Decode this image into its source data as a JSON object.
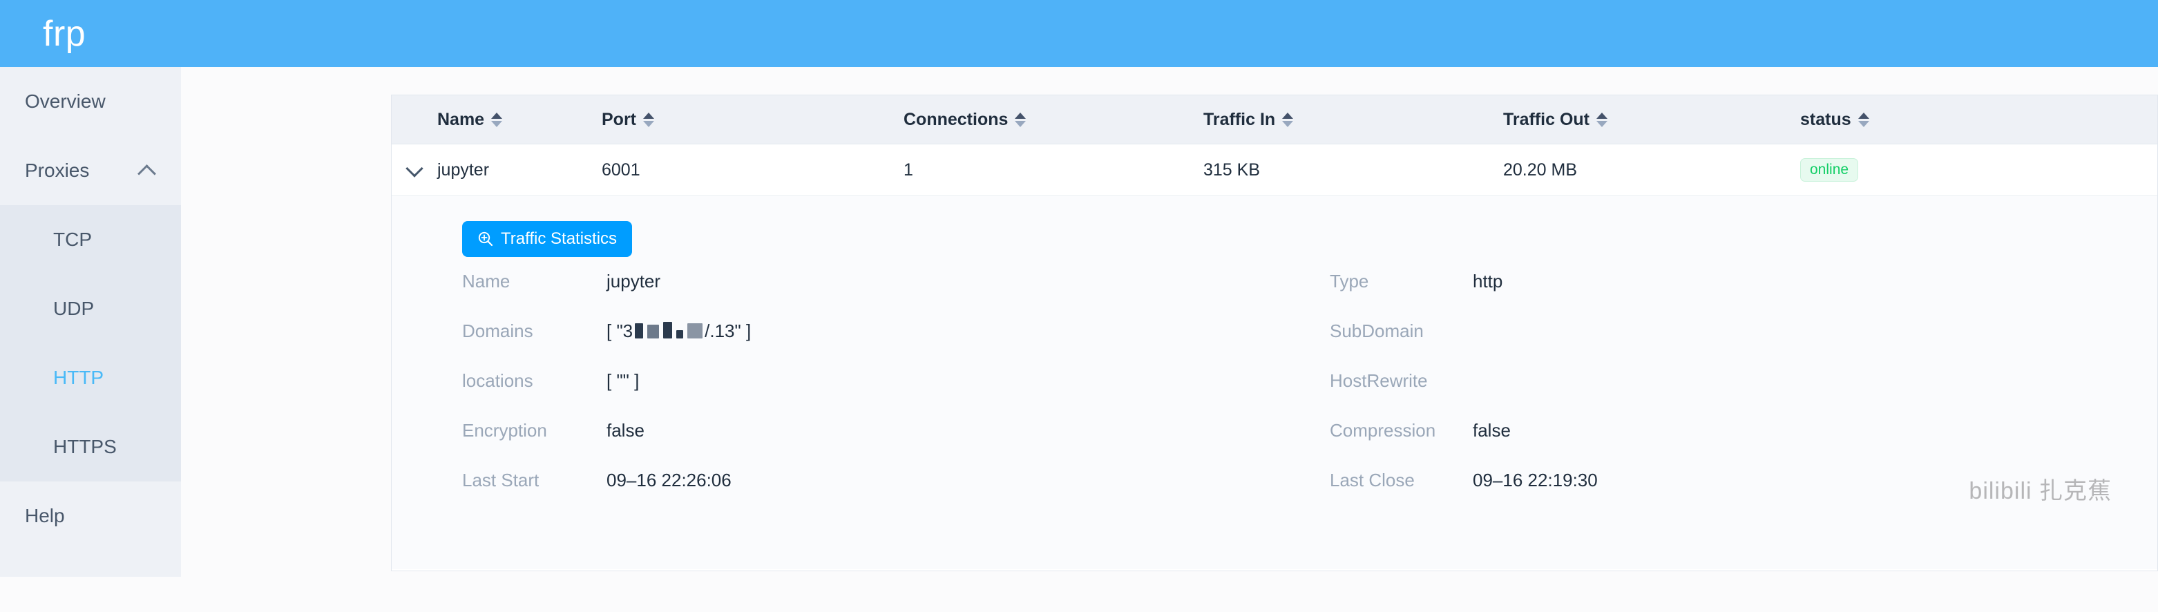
{
  "header": {
    "logo": "frp",
    "brand_color": "#4fb2f8"
  },
  "sidebar": {
    "overview_label": "Overview",
    "proxies_label": "Proxies",
    "proxies_collapse_icon": "chevron-up-icon",
    "submenu": [
      {
        "label": "TCP",
        "active": false
      },
      {
        "label": "UDP",
        "active": false
      },
      {
        "label": "HTTP",
        "active": true
      },
      {
        "label": "HTTPS",
        "active": false
      }
    ],
    "help_label": "Help",
    "active_color": "#49b9f7"
  },
  "table": {
    "columns": [
      {
        "label": "Name",
        "sort_icon": "sort-icon"
      },
      {
        "label": "Port",
        "sort_icon": "sort-icon"
      },
      {
        "label": "Connections",
        "sort_icon": "sort-icon"
      },
      {
        "label": "Traffic In",
        "sort_icon": "sort-icon"
      },
      {
        "label": "Traffic Out",
        "sort_icon": "sort-icon"
      },
      {
        "label": "status",
        "sort_icon": "sort-icon"
      }
    ],
    "row": {
      "expand_icon": "chevron-down-icon",
      "name": "jupyter",
      "port": "6001",
      "connections": "1",
      "traffic_in": "315 KB",
      "traffic_out": "20.20 MB",
      "status": "online",
      "status_color": "#13ce66"
    }
  },
  "detail": {
    "stats_button": {
      "label": "Traffic Statistics",
      "icon": "zoom-in-icon",
      "color": "#009dff"
    },
    "fields": [
      {
        "left_label": "Name",
        "left_value": "jupyter",
        "right_label": "Type",
        "right_value": "http"
      },
      {
        "left_label": "Domains",
        "left_value_prefix": "[ \"3",
        "left_value_suffix": "/.13\" ]",
        "left_redacted": true,
        "right_label": "SubDomain",
        "right_value": ""
      },
      {
        "left_label": "locations",
        "left_value": "[ \"\" ]",
        "right_label": "HostRewrite",
        "right_value": ""
      },
      {
        "left_label": "Encryption",
        "left_value": "false",
        "right_label": "Compression",
        "right_value": "false"
      },
      {
        "left_label": "Last Start",
        "left_value": "09–16 22:26:06",
        "right_label": "Last Close",
        "right_value": "09–16 22:19:30"
      }
    ]
  },
  "watermark": "bilibili 扎克蕉"
}
